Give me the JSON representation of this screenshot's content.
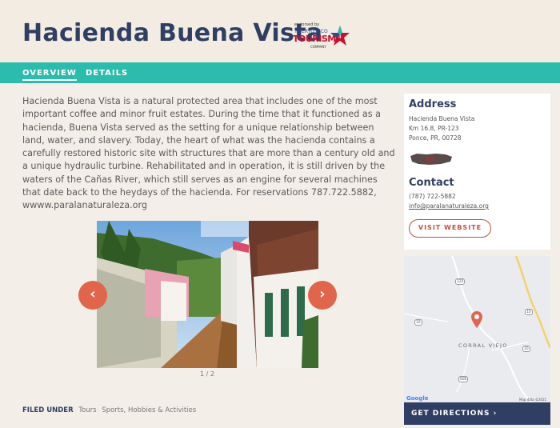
{
  "header": {
    "title": "Hacienda Buena Vista",
    "endorsement": {
      "small_text": "endorsed by",
      "brand_top": "PUERTO RICO",
      "brand_main": "TOURISM",
      "brand_bottom": "COMPANY"
    }
  },
  "tabs": [
    {
      "label": "OVERVIEW",
      "active": true
    },
    {
      "label": "DETAILS",
      "active": false
    }
  ],
  "description": "Hacienda Buena Vista is a natural protected area that includes one of the most important coffee and minor fruit estates. During the time that it functioned as a hacienda, Buena Vista served as the setting for a unique relationship between land, water, and slavery. Today, the heart of what was the hacienda contains a carefully restored historic site with structures that are more than a century old and a unique hydraulic turbine. Rehabilitated and in operation, it is still driven by the waters of the Cañas River, which still serves as an engine for several machines that date back to the heydays of the hacienda. For reservations 787.722.5882, wwww.paralanaturaleza.org",
  "carousel": {
    "prev_icon": "‹",
    "next_icon": "›",
    "counter": "1 / 2"
  },
  "filed_under": {
    "label": "FILED UNDER",
    "tags": [
      "Tours",
      "Sports, Hobbies & Activities"
    ]
  },
  "address": {
    "heading": "Address",
    "lines": [
      "Hacienda Buena Vista",
      "Km 16.8, PR-123",
      "Ponce, PR, 00728"
    ]
  },
  "contact": {
    "heading": "Contact",
    "phone": "(787) 722-5882",
    "email": "info@paralanaturaleza.org",
    "visit_label": "VISIT WEBSITE"
  },
  "map": {
    "place_label": "CORRAL VIEJO",
    "route_labels": [
      "123",
      "10",
      "10",
      "505",
      "10"
    ],
    "google_label": "Google",
    "map_data": "Map data ©2021"
  },
  "directions_label": "GET DIRECTIONS ›",
  "colors": {
    "navy": "#2f3f63",
    "teal": "#2bbcad",
    "coral": "#e0654a",
    "background": "#f3efe8"
  }
}
